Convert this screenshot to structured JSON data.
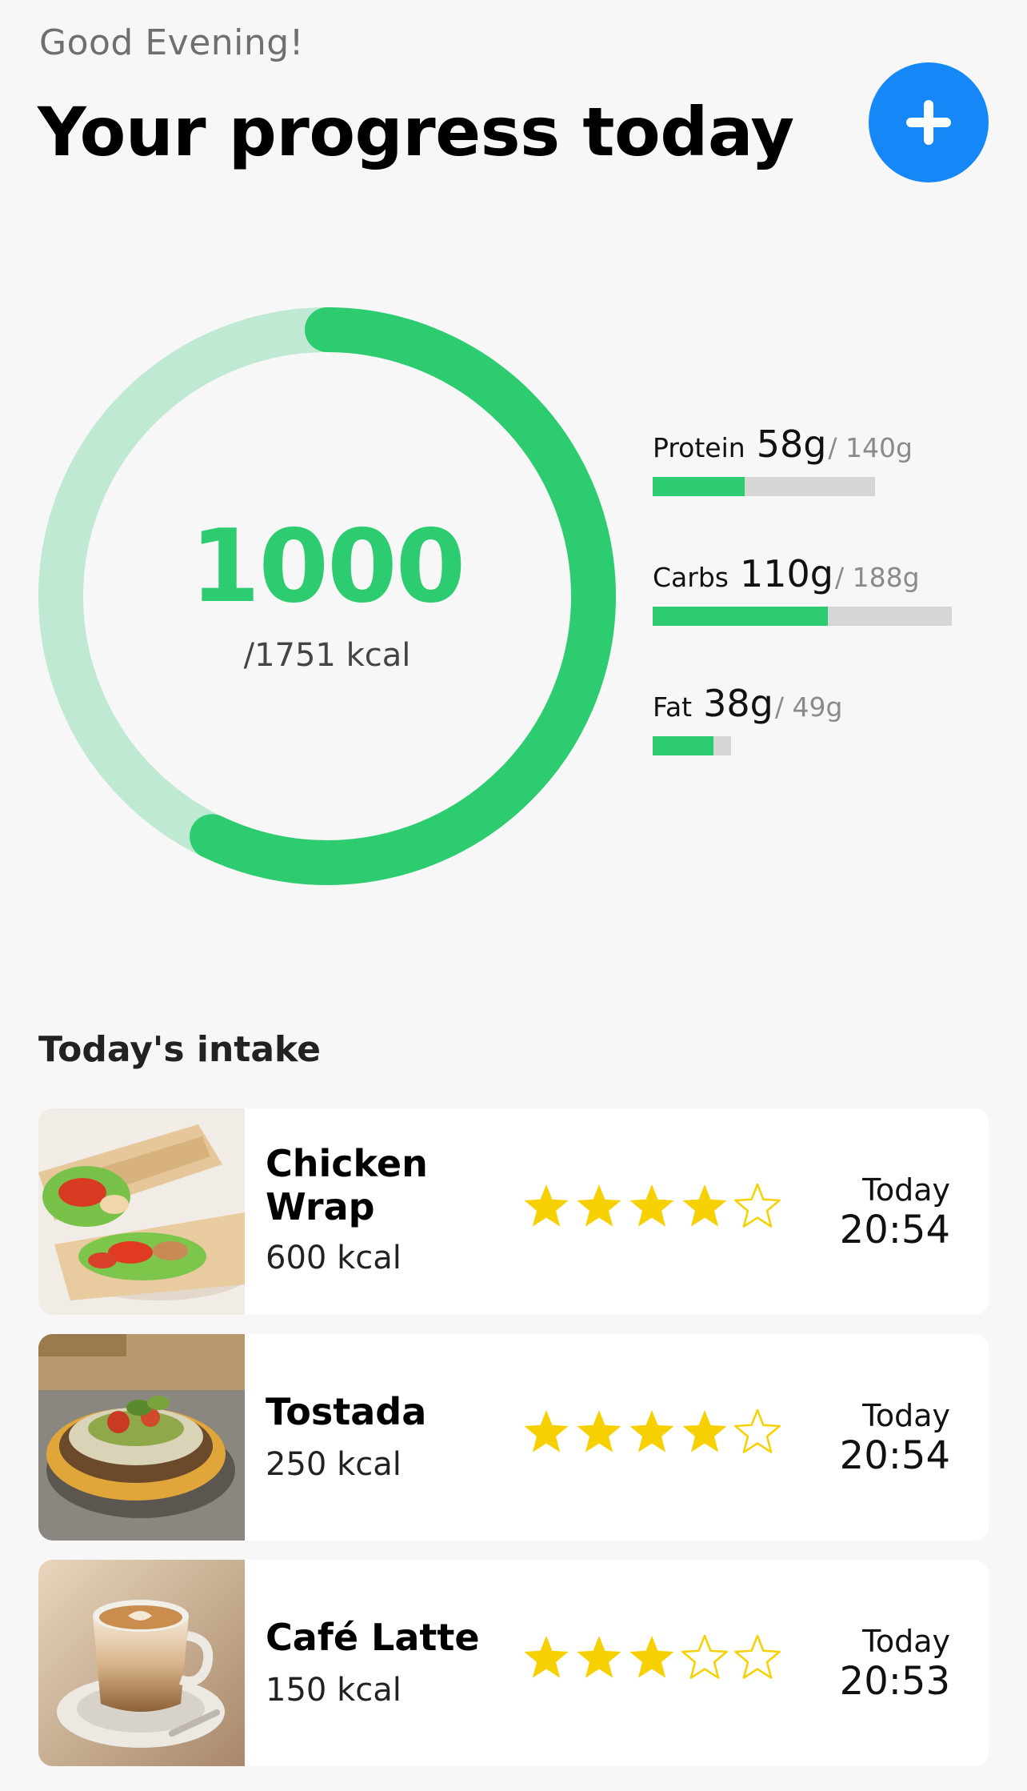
{
  "header": {
    "greeting": "Good Evening!",
    "title": "Your progress today",
    "add_button_icon": "plus-icon"
  },
  "calories": {
    "value": "1000",
    "goal_text": "/1751 kcal",
    "consumed": 1000,
    "goal": 1751,
    "colors": {
      "progress": "#2ecc71",
      "track": "#bfe9d2"
    }
  },
  "macros": [
    {
      "name": "Protein",
      "value": "58g",
      "goal": "/ 140g",
      "progress": 0.414
    },
    {
      "name": "Carbs",
      "value": "110g",
      "goal": "/ 188g",
      "progress": 0.585
    },
    {
      "name": "Fat",
      "value": "38g",
      "goal": "/ 49g",
      "progress": 0.776
    }
  ],
  "intake": {
    "title": "Today's intake",
    "items": [
      {
        "name": "Chicken Wrap",
        "kcal": "600 kcal",
        "rating": 4,
        "max_rating": 5,
        "day": "Today",
        "time": "20:54",
        "image_icon": "chicken-wrap-photo"
      },
      {
        "name": "Tostada",
        "kcal": "250 kcal",
        "rating": 4,
        "max_rating": 5,
        "day": "Today",
        "time": "20:54",
        "image_icon": "tostada-photo"
      },
      {
        "name": "Café Latte",
        "kcal": "150 kcal",
        "rating": 3,
        "max_rating": 5,
        "day": "Today",
        "time": "20:53",
        "image_icon": "cafe-latte-photo"
      }
    ]
  },
  "colors": {
    "accent_blue": "#1687f7",
    "green": "#2ecc71",
    "star_gold": "#f7d000"
  }
}
